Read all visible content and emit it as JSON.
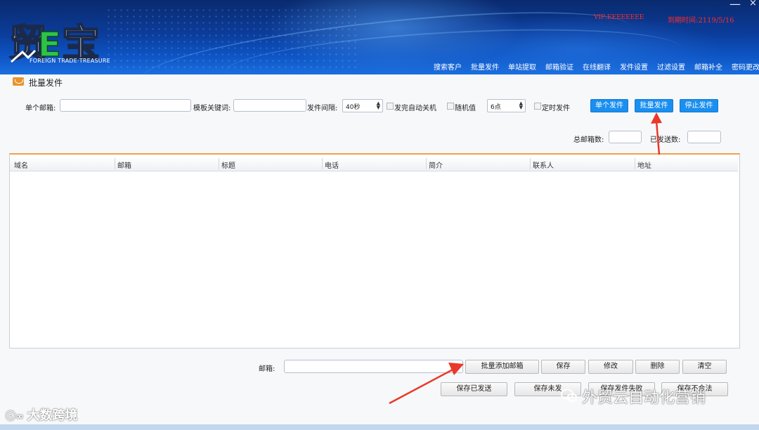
{
  "window": {
    "minimize_glyph": "—",
    "close_glyph": "×"
  },
  "brand": {
    "logo_text": "贸E宝",
    "logo_sub": "FOREIGN TRADE·TREASURE"
  },
  "account": {
    "vip": "VIP:EEEEEEEE",
    "expire": "到期时间:2119/5/16"
  },
  "nav": [
    "搜索客户",
    "批量发件",
    "单站提取",
    "邮箱验证",
    "在线翻译",
    "发件设置",
    "过滤设置",
    "邮箱补全",
    "密码更改"
  ],
  "section": {
    "title": "批量发件"
  },
  "form": {
    "single_email_label": "单个邮箱:",
    "single_email_value": "",
    "template_keyword_label": "模板关键词:",
    "template_keyword_value": "",
    "send_interval_label": "发件间隔:",
    "send_interval_value": "40秒",
    "auto_shutdown_label": "发完自动关机",
    "random_label": "随机值",
    "hour_value": "6点",
    "timed_send_label": "定时发件",
    "btn_single": "单个发件",
    "btn_batch": "批量发件",
    "btn_stop": "停止发件",
    "total_label": "总邮箱数:",
    "sent_label": "已发送数:",
    "total_value": "",
    "sent_value": ""
  },
  "table": {
    "columns": [
      "域名",
      "邮箱",
      "标题",
      "电话",
      "简介",
      "联系人",
      "地址"
    ],
    "rows": []
  },
  "bottom": {
    "email_label": "邮箱:",
    "email_value": "",
    "btn_batch_add": "批量添加邮箱",
    "btn_save": "保存",
    "btn_edit": "修改",
    "btn_delete": "删除",
    "btn_clear": "清空",
    "btn_save_sent": "保存已发送",
    "btn_save_unsent": "保存未发",
    "btn_save_fail": "保存发件失败",
    "btn_save_reject": "保存不合法"
  },
  "watermark": {
    "left": "大数跨境",
    "right": "外贸云自动化营销"
  },
  "colors": {
    "accent_blue": "#1a8ff0",
    "arrow_red": "#e8392a",
    "table_top": "#f3a04a",
    "warning_red": "#ff2b2b"
  }
}
